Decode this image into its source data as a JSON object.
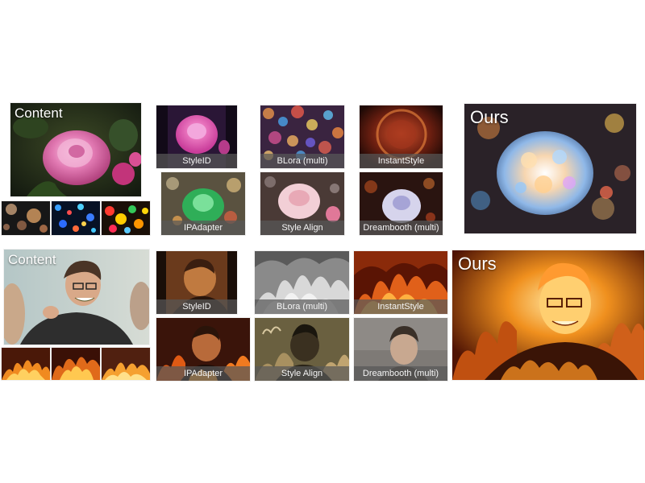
{
  "rows": [
    {
      "content_label": "Content",
      "method_labels": [
        "StyleID",
        "BLora (multi)",
        "InstantStyle",
        "IPAdapter",
        "Style Align",
        "Dreambooth (multi)"
      ],
      "ours_label": "Ours"
    },
    {
      "content_label": "Content",
      "method_labels": [
        "StyleID",
        "BLora (multi)",
        "InstantStyle",
        "IPAdapter",
        "Style Align",
        "Dreambooth (multi)"
      ],
      "ours_label": "Ours"
    }
  ]
}
